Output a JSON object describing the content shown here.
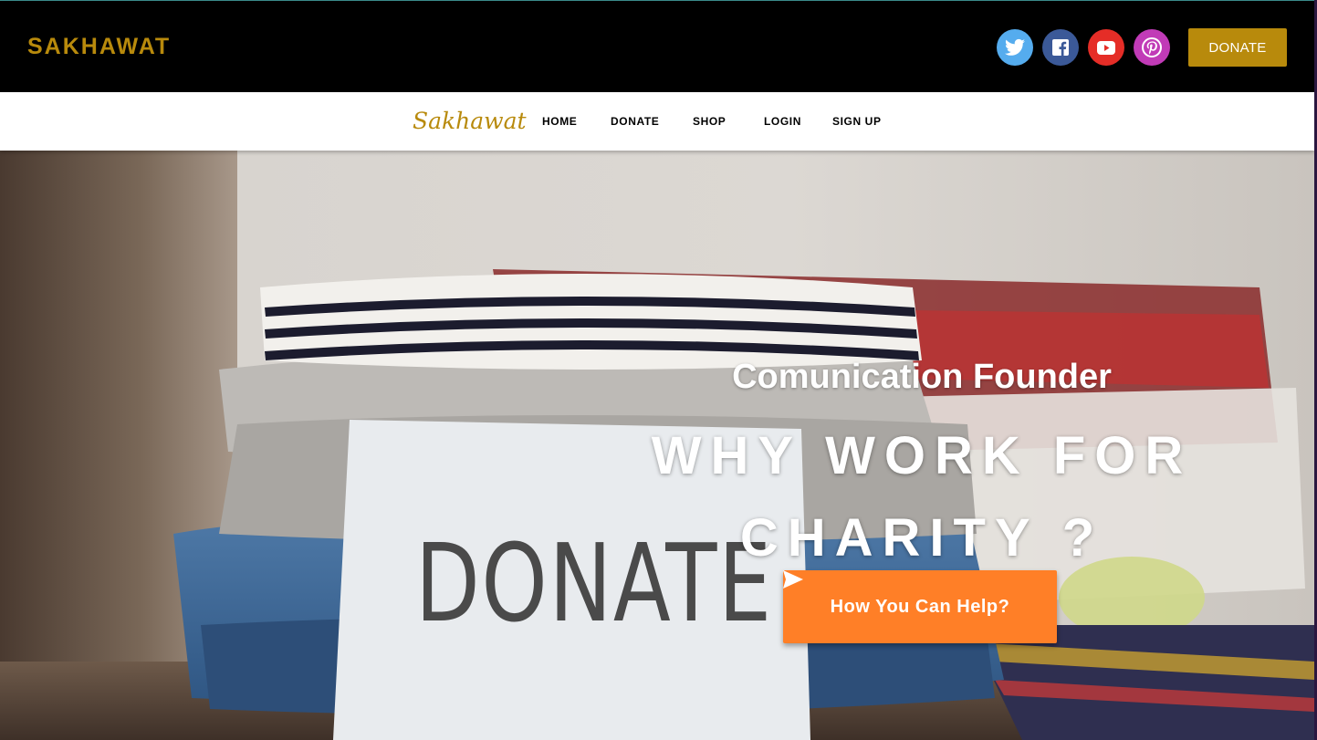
{
  "header": {
    "brand": "SAKHAWAT",
    "donate_label": "DONATE",
    "socials": [
      {
        "icon": "twitter-icon",
        "color": "#55acee"
      },
      {
        "icon": "facebook-icon",
        "color": "#3b5998"
      },
      {
        "icon": "youtube-icon",
        "color": "#e52d27"
      },
      {
        "icon": "pinterest-icon",
        "color": "#c13bb7"
      }
    ]
  },
  "nav": {
    "logo": "Sakhawat",
    "links": [
      "HOME",
      "DONATE",
      "SHOP",
      "LOGIN",
      "SIGN UP"
    ]
  },
  "hero": {
    "subtitle": "Comunication Founder",
    "title_line1": "WHY WORK FOR",
    "title_line2": "CHARITY ?",
    "cta_label": "How You Can Help?",
    "card_text": "DONATE"
  },
  "colors": {
    "brand_gold": "#b88a0c",
    "cta_orange": "#ff7f27"
  }
}
